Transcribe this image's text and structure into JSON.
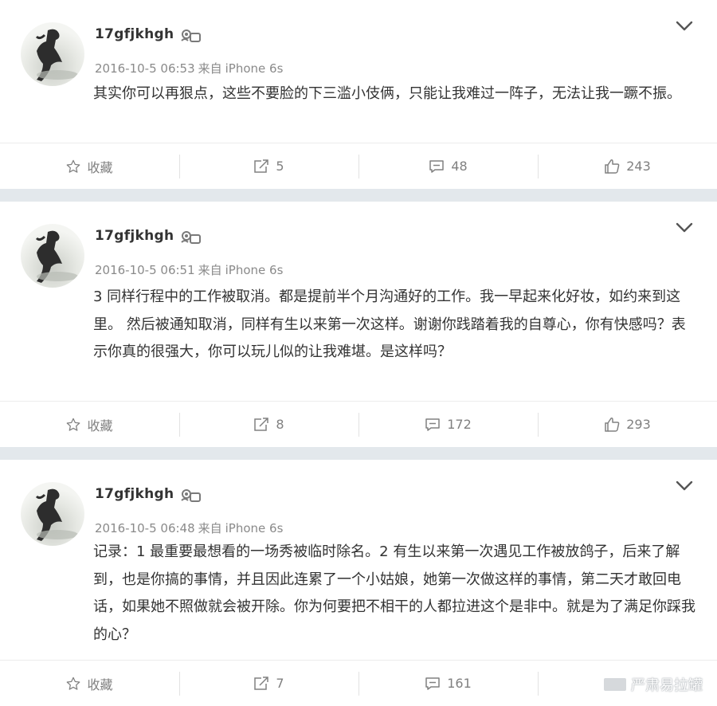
{
  "posts": [
    {
      "username": "17gfjkhgh",
      "timestamp": "2016-10-5 06:53",
      "source_prefix": "来自",
      "source_device": "iPhone 6s",
      "text": "其实你可以再狠点，这些不要脸的下三滥小伎俩，只能让我难过一阵子，无法让我一蹶不振。",
      "actions": {
        "favorite": "收藏",
        "repost": "5",
        "comment": "48",
        "like": "243"
      }
    },
    {
      "username": "17gfjkhgh",
      "timestamp": "2016-10-5 06:51",
      "source_prefix": "来自",
      "source_device": "iPhone 6s",
      "text": "3 同样行程中的工作被取消。都是提前半个月沟通好的工作。我一早起来化好妆，如约来到这里。 然后被通知取消，同样有生以来第一次这样。谢谢你践踏着我的自尊心，你有快感吗？表示你真的很强大，你可以玩儿似的让我难堪。是这样吗？",
      "actions": {
        "favorite": "收藏",
        "repost": "8",
        "comment": "172",
        "like": "293"
      }
    },
    {
      "username": "17gfjkhgh",
      "timestamp": "2016-10-5 06:48",
      "source_prefix": "来自",
      "source_device": "iPhone 6s",
      "text": "记录：1 最重要最想看的一场秀被临时除名。2 有生以来第一次遇见工作被放鸽子，后来了解到，也是你搞的事情，并且因此连累了一个小姑娘，她第一次做这样的事情，第二天才敢回电话，如果她不照做就会被开除。你为何要把不相干的人都拉进这个是非中。就是为了满足你踩我的心？",
      "actions": {
        "favorite": "收藏",
        "repost": "7",
        "comment": "161",
        "like": ""
      }
    }
  ],
  "watermark": "严肃易拉罐",
  "colors": {
    "page_bg": "#e3e8ec",
    "card_bg": "#ffffff",
    "meta_gray": "#8a8a8a",
    "text": "#333333"
  }
}
